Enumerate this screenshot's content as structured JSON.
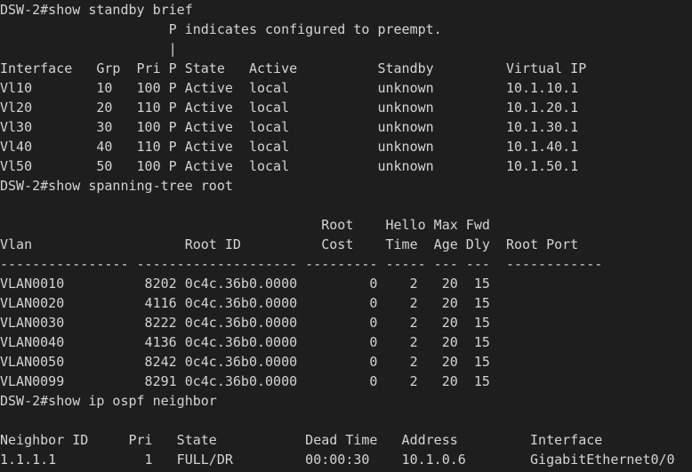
{
  "terminal": {
    "lines": [
      "DSW-2#show standby brief",
      "                     P indicates configured to preempt.",
      "                     |",
      "Interface   Grp  Pri P State   Active          Standby         Virtual IP",
      "Vl10        10   100 P Active  local           unknown         10.1.10.1",
      "Vl20        20   110 P Active  local           unknown         10.1.20.1",
      "Vl30        30   100 P Active  local           unknown         10.1.30.1",
      "Vl40        40   110 P Active  local           unknown         10.1.40.1",
      "Vl50        50   100 P Active  local           unknown         10.1.50.1",
      "DSW-2#show spanning-tree root",
      "",
      "                                        Root    Hello Max Fwd",
      "Vlan                   Root ID          Cost    Time  Age Dly  Root Port",
      "---------------- -------------------- --------- ----- --- ---  ------------",
      "VLAN0010          8202 0c4c.36b0.0000         0    2   20  15",
      "VLAN0020          4116 0c4c.36b0.0000         0    2   20  15",
      "VLAN0030          8222 0c4c.36b0.0000         0    2   20  15",
      "VLAN0040          4136 0c4c.36b0.0000         0    2   20  15",
      "VLAN0050          8242 0c4c.36b0.0000         0    2   20  15",
      "VLAN0099          8291 0c4c.36b0.0000         0    2   20  15",
      "DSW-2#show ip ospf neighbor",
      "",
      "Neighbor ID     Pri   State           Dead Time   Address         Interface",
      "1.1.1.1           1   FULL/DR         00:00:30    10.1.0.6        GigabitEthernet0/0"
    ]
  }
}
